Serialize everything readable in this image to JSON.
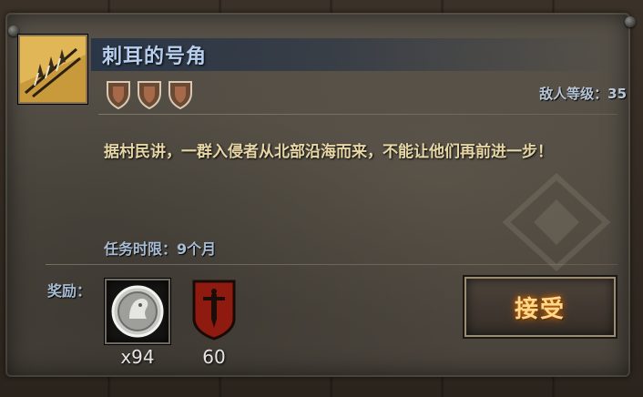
{
  "quest": {
    "title": "刺耳的号角",
    "icon": "spiked-barricade-icon",
    "difficulty_shields": 3,
    "enemy_level_label": "敌人等级：35",
    "description": "据村民讲，一群入侵者从北部沿海而来，不能让他们再前进一步！",
    "time_limit": "任务时限：9个月"
  },
  "rewards": {
    "label": "奖励：",
    "items": [
      {
        "icon": "silver-coin-icon",
        "count": "x94"
      },
      {
        "icon": "red-sword-banner-icon",
        "count": "60"
      }
    ]
  },
  "actions": {
    "accept_label": "接受"
  },
  "colors": {
    "title": "#b8d0f0",
    "description": "#e8d7a6",
    "accept_glow": "#ffd98a",
    "banner_red": "#8e1a10"
  }
}
